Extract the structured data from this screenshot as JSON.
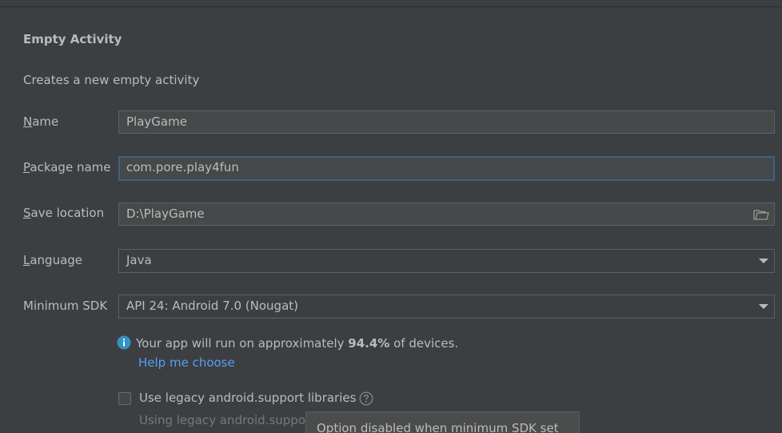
{
  "header": {
    "title": "Empty Activity",
    "description": "Creates a new empty activity"
  },
  "form": {
    "name": {
      "label_mnemonic": "N",
      "label_rest": "ame",
      "value": "PlayGame"
    },
    "package_name": {
      "label_mnemonic": "P",
      "label_rest": "ackage name",
      "value": "com.pore.play4fun"
    },
    "save_location": {
      "label_mnemonic": "S",
      "label_rest": "ave location",
      "value": "D:\\PlayGame",
      "icon": "folder-icon"
    },
    "language": {
      "label_mnemonic": "L",
      "label_rest": "anguage",
      "value": "Java"
    },
    "minimum_sdk": {
      "label": "Minimum SDK",
      "value": "API 24: Android 7.0 (Nougat)"
    }
  },
  "info": {
    "icon": "info-icon",
    "text_before": "Your app will run on approximately ",
    "percent": "94.4%",
    "text_after": " of devices.",
    "help_link": "Help me choose"
  },
  "legacy": {
    "checked": false,
    "label": "Use legacy android.support libraries",
    "help_icon": "question-icon",
    "sub_text": "Using legacy android.suppor",
    "sub_text2": "",
    "tooltip": "Option disabled when minimum SDK set"
  },
  "colors": {
    "background": "#3c3f41",
    "field_bg": "#45494a",
    "focus_border": "#3d6185",
    "link": "#589df6",
    "info_icon": "#3592c4"
  }
}
